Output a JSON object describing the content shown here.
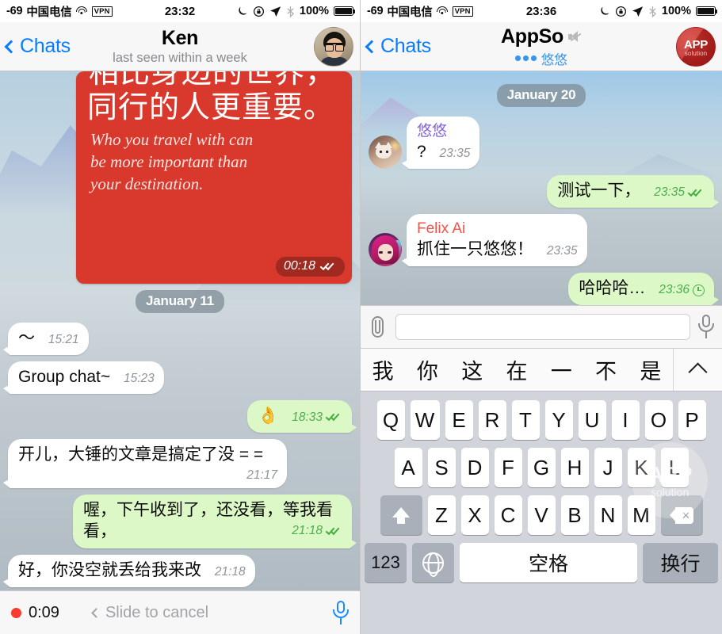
{
  "left_phone": {
    "status_bar": {
      "signal": "-69",
      "carrier": "中国电信",
      "wifi_icon": "wifi-icon",
      "vpn_badge": "VPN",
      "clock": "23:32",
      "dnd_icon": "moon-icon",
      "rotation_lock_icon": "rotation-lock-icon",
      "location_icon": "location-arrow-icon",
      "bluetooth_icon": "bluetooth-icon",
      "battery_percent": "100%",
      "battery_icon": "battery-full-icon"
    },
    "nav": {
      "back_label": "Chats",
      "back_icon": "chevron-left-icon",
      "title": "Ken",
      "subtitle": "last seen within a week",
      "avatar_name": "contact-avatar-ken"
    },
    "image_card": {
      "cn_line1": "相比身边的世界，",
      "cn_line2": "同行的人更重要。",
      "en_line1": "Who you travel with can",
      "en_line2": "be more important than",
      "en_line3": "your destination.",
      "time": "00:18",
      "status_icon": "double-check-icon"
    },
    "day_separator": "January 11",
    "messages": [
      {
        "dir": "in",
        "text": "〜",
        "time": "15:21",
        "status": ""
      },
      {
        "dir": "in",
        "text": "Group chat~",
        "time": "15:23",
        "status": ""
      },
      {
        "dir": "out",
        "text": "👌",
        "time": "18:33",
        "status": "double-check-icon"
      },
      {
        "dir": "in",
        "text": "开儿，大锤的文章是搞定了没 = =",
        "time": "21:17",
        "status": ""
      },
      {
        "dir": "out",
        "text": "喔，下午收到了，还没看，等我看看，",
        "time": "21:18",
        "status": "double-check-icon"
      },
      {
        "dir": "in",
        "text": "好，你没空就丢给我来改",
        "time": "21:18",
        "status": ""
      }
    ],
    "record_bar": {
      "dot_icon": "recording-dot-icon",
      "elapsed": "0:09",
      "cancel_chevron_icon": "chevron-left-icon",
      "cancel_label": "Slide to cancel",
      "mic_icon": "microphone-icon"
    }
  },
  "right_phone": {
    "status_bar": {
      "signal": "-69",
      "carrier": "中国电信",
      "wifi_icon": "wifi-icon",
      "vpn_badge": "VPN",
      "clock": "23:36",
      "dnd_icon": "moon-icon",
      "rotation_lock_icon": "rotation-lock-icon",
      "location_icon": "location-arrow-icon",
      "bluetooth_icon": "bluetooth-icon",
      "battery_percent": "100%",
      "battery_icon": "battery-full-icon"
    },
    "nav": {
      "back_label": "Chats",
      "back_icon": "chevron-left-icon",
      "title": "AppSo",
      "mute_icon": "mute-speaker-icon",
      "typing_member": "悠悠",
      "typing_dots_icon": "typing-dots-icon",
      "avatar_line1": "APP",
      "avatar_line2": "solution",
      "avatar_name": "group-avatar-appso"
    },
    "day_separator": "January 20",
    "messages": [
      {
        "dir": "in",
        "sender": "悠悠",
        "sender_color": "#8464d6",
        "avatar": "cat-avatar",
        "text": "?",
        "time": "23:35",
        "status": ""
      },
      {
        "dir": "out",
        "sender": "",
        "text": "测试一下，",
        "time": "23:35",
        "status": "double-check-icon"
      },
      {
        "dir": "in",
        "sender": "Felix Ai",
        "sender_color": "#f2534d",
        "avatar": "anime-avatar",
        "text": "抓住一只悠悠！",
        "time": "23:35",
        "status": ""
      },
      {
        "dir": "out",
        "sender": "",
        "text": "哈哈哈…",
        "time": "23:36",
        "status": "pending-clock-icon"
      }
    ],
    "input_bar": {
      "attach_icon": "paperclip-icon",
      "input_value": "",
      "input_placeholder": "",
      "mic_icon": "microphone-icon"
    },
    "keyboard": {
      "suggestions": [
        "我",
        "你",
        "这",
        "在",
        "一",
        "不",
        "是"
      ],
      "expand_icon": "chevron-up-icon",
      "row1": [
        "Q",
        "W",
        "E",
        "R",
        "T",
        "Y",
        "U",
        "I",
        "O",
        "P"
      ],
      "row2": [
        "A",
        "S",
        "D",
        "F",
        "G",
        "H",
        "J",
        "K",
        "L"
      ],
      "row3": [
        "Z",
        "X",
        "C",
        "V",
        "B",
        "N",
        "M"
      ],
      "shift_icon": "shift-arrow-icon",
      "delete_icon": "backspace-icon",
      "numbers_key": "123",
      "globe_icon": "globe-icon",
      "space_key": "空格",
      "return_key": "换行"
    },
    "watermark": {
      "line1": "APP",
      "line2": "solution"
    }
  },
  "colors": {
    "accent_blue": "#0a7cff",
    "bubble_out": "#dcf8c6",
    "bubble_in": "#ffffff",
    "card_red": "#d8392c",
    "tick_green": "#3fae3f",
    "rec_red": "#fa3a2e"
  }
}
